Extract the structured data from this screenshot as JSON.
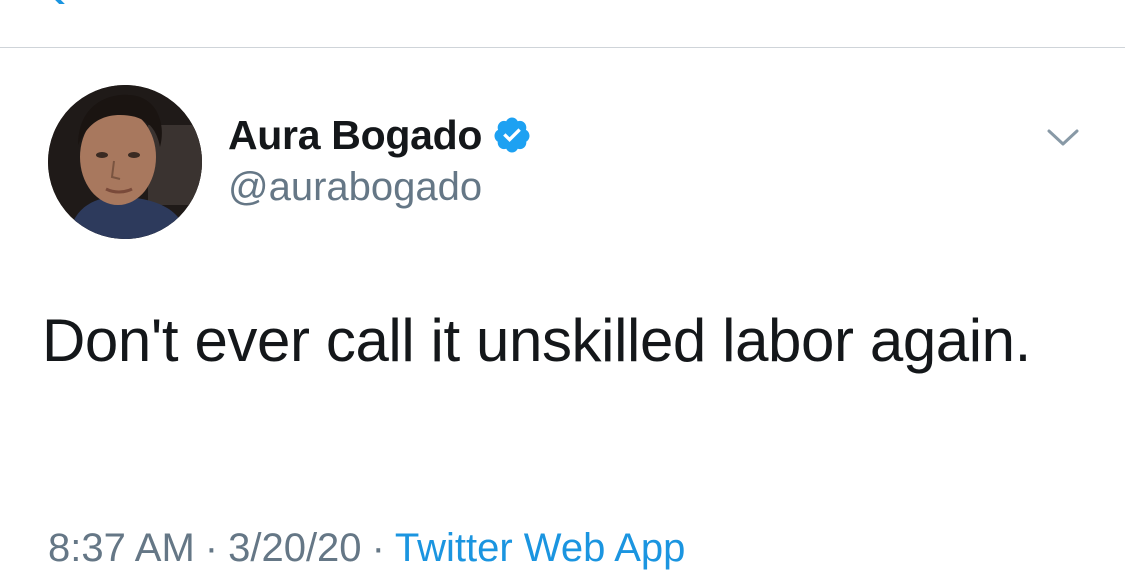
{
  "app": {
    "accent_color": "#1b95e0",
    "back_icon": "chevron-left-icon"
  },
  "tweet": {
    "author": {
      "display_name": "Aura Bogado",
      "handle": "@aurabogado",
      "verified": true,
      "verified_icon": "verified-badge-icon"
    },
    "menu_icon": "chevron-down-icon",
    "text": "Don't ever call it unskilled labor again.",
    "time": "8:37 AM",
    "separator": "·",
    "date": "3/20/20",
    "source": "Twitter Web App"
  }
}
